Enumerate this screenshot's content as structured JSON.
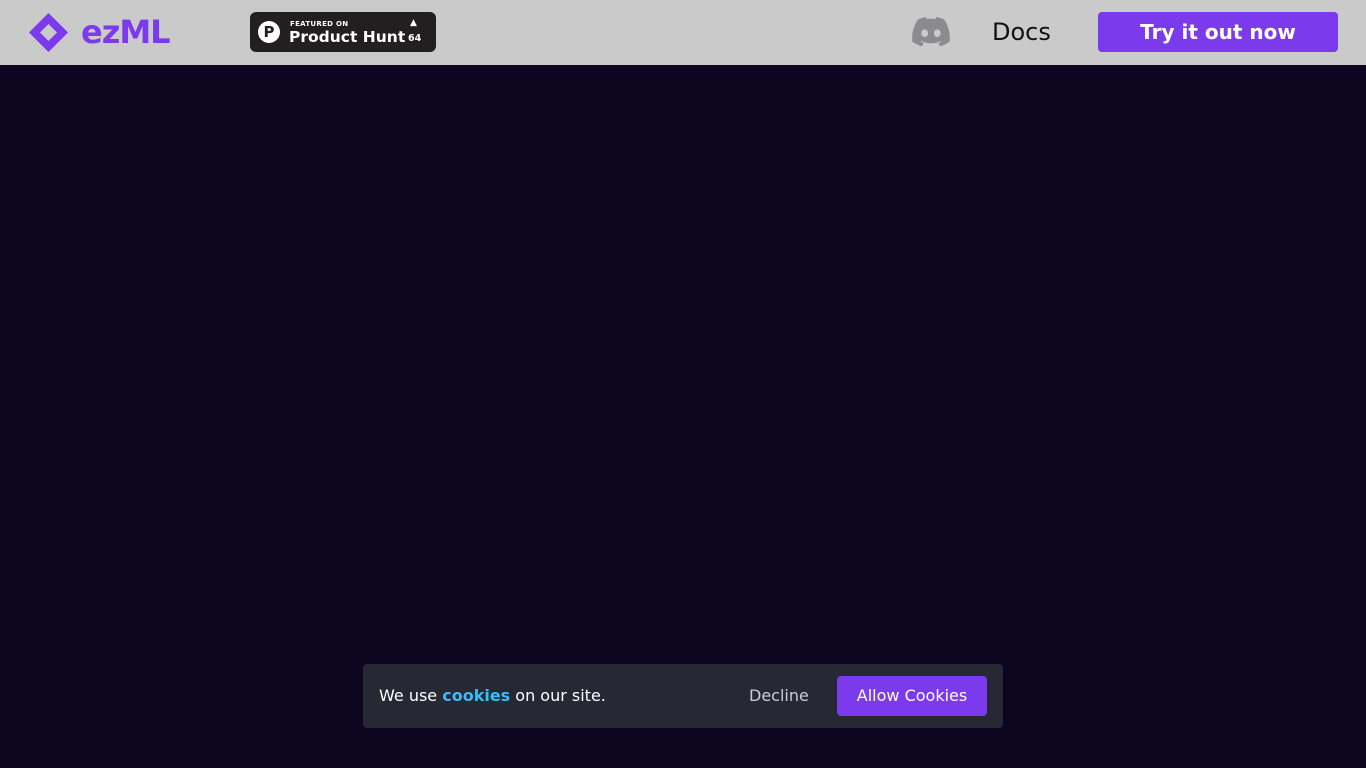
{
  "header": {
    "logo_text": "ezML",
    "brand_color": "#7c3aed",
    "product_hunt": {
      "small_label": "FEATURED ON",
      "label": "Product Hunt",
      "upvote_arrow": "▲",
      "count": "64",
      "circle_letter": "P"
    },
    "discord_icon": "discord-icon",
    "docs_label": "Docs",
    "cta_label": "Try it out now"
  },
  "cookie_banner": {
    "text_before": "We use ",
    "link_text": "cookies",
    "text_after": " on our site.",
    "decline_label": "Decline",
    "allow_label": "Allow Cookies",
    "link_color": "#38bdf8"
  },
  "colors": {
    "header_bg": "#cacaca",
    "page_bg": "#0e0620",
    "banner_bg": "#262833"
  }
}
